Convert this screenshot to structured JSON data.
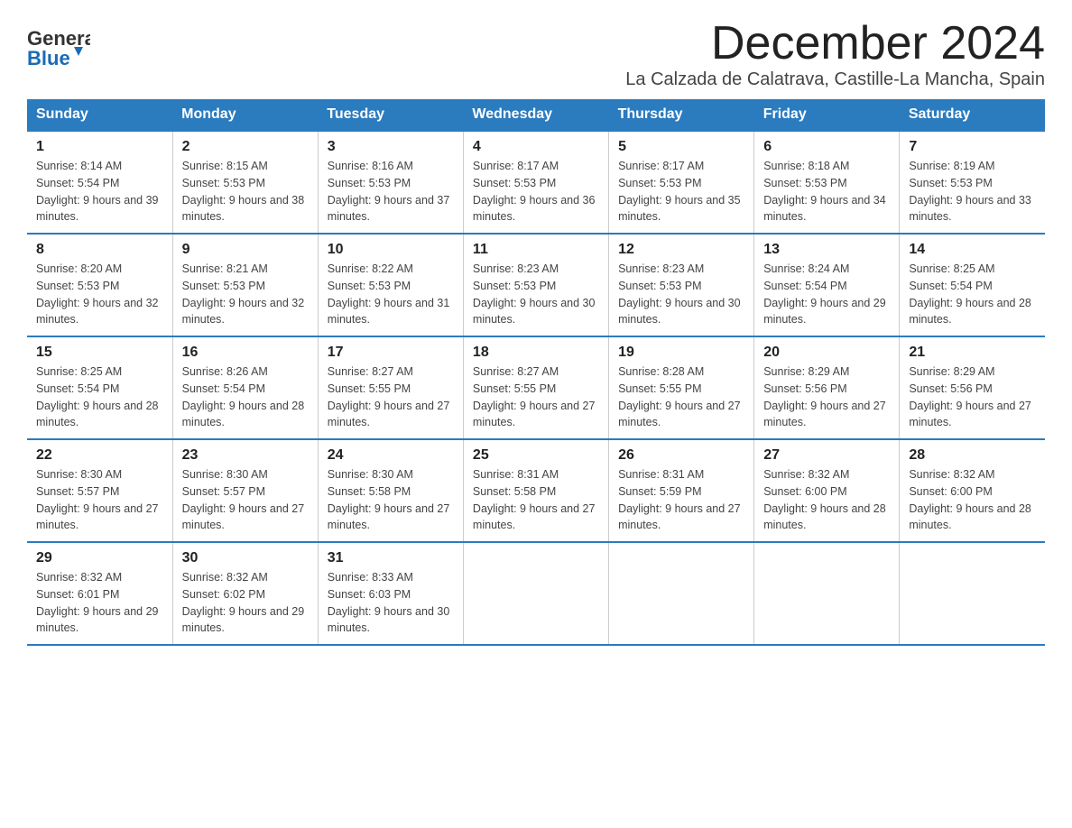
{
  "header": {
    "logo_general": "General",
    "logo_blue": "Blue",
    "month_title": "December 2024",
    "location": "La Calzada de Calatrava, Castille-La Mancha, Spain"
  },
  "days_of_week": [
    "Sunday",
    "Monday",
    "Tuesday",
    "Wednesday",
    "Thursday",
    "Friday",
    "Saturday"
  ],
  "weeks": [
    [
      {
        "day": "1",
        "sunrise": "Sunrise: 8:14 AM",
        "sunset": "Sunset: 5:54 PM",
        "daylight": "Daylight: 9 hours and 39 minutes."
      },
      {
        "day": "2",
        "sunrise": "Sunrise: 8:15 AM",
        "sunset": "Sunset: 5:53 PM",
        "daylight": "Daylight: 9 hours and 38 minutes."
      },
      {
        "day": "3",
        "sunrise": "Sunrise: 8:16 AM",
        "sunset": "Sunset: 5:53 PM",
        "daylight": "Daylight: 9 hours and 37 minutes."
      },
      {
        "day": "4",
        "sunrise": "Sunrise: 8:17 AM",
        "sunset": "Sunset: 5:53 PM",
        "daylight": "Daylight: 9 hours and 36 minutes."
      },
      {
        "day": "5",
        "sunrise": "Sunrise: 8:17 AM",
        "sunset": "Sunset: 5:53 PM",
        "daylight": "Daylight: 9 hours and 35 minutes."
      },
      {
        "day": "6",
        "sunrise": "Sunrise: 8:18 AM",
        "sunset": "Sunset: 5:53 PM",
        "daylight": "Daylight: 9 hours and 34 minutes."
      },
      {
        "day": "7",
        "sunrise": "Sunrise: 8:19 AM",
        "sunset": "Sunset: 5:53 PM",
        "daylight": "Daylight: 9 hours and 33 minutes."
      }
    ],
    [
      {
        "day": "8",
        "sunrise": "Sunrise: 8:20 AM",
        "sunset": "Sunset: 5:53 PM",
        "daylight": "Daylight: 9 hours and 32 minutes."
      },
      {
        "day": "9",
        "sunrise": "Sunrise: 8:21 AM",
        "sunset": "Sunset: 5:53 PM",
        "daylight": "Daylight: 9 hours and 32 minutes."
      },
      {
        "day": "10",
        "sunrise": "Sunrise: 8:22 AM",
        "sunset": "Sunset: 5:53 PM",
        "daylight": "Daylight: 9 hours and 31 minutes."
      },
      {
        "day": "11",
        "sunrise": "Sunrise: 8:23 AM",
        "sunset": "Sunset: 5:53 PM",
        "daylight": "Daylight: 9 hours and 30 minutes."
      },
      {
        "day": "12",
        "sunrise": "Sunrise: 8:23 AM",
        "sunset": "Sunset: 5:53 PM",
        "daylight": "Daylight: 9 hours and 30 minutes."
      },
      {
        "day": "13",
        "sunrise": "Sunrise: 8:24 AM",
        "sunset": "Sunset: 5:54 PM",
        "daylight": "Daylight: 9 hours and 29 minutes."
      },
      {
        "day": "14",
        "sunrise": "Sunrise: 8:25 AM",
        "sunset": "Sunset: 5:54 PM",
        "daylight": "Daylight: 9 hours and 28 minutes."
      }
    ],
    [
      {
        "day": "15",
        "sunrise": "Sunrise: 8:25 AM",
        "sunset": "Sunset: 5:54 PM",
        "daylight": "Daylight: 9 hours and 28 minutes."
      },
      {
        "day": "16",
        "sunrise": "Sunrise: 8:26 AM",
        "sunset": "Sunset: 5:54 PM",
        "daylight": "Daylight: 9 hours and 28 minutes."
      },
      {
        "day": "17",
        "sunrise": "Sunrise: 8:27 AM",
        "sunset": "Sunset: 5:55 PM",
        "daylight": "Daylight: 9 hours and 27 minutes."
      },
      {
        "day": "18",
        "sunrise": "Sunrise: 8:27 AM",
        "sunset": "Sunset: 5:55 PM",
        "daylight": "Daylight: 9 hours and 27 minutes."
      },
      {
        "day": "19",
        "sunrise": "Sunrise: 8:28 AM",
        "sunset": "Sunset: 5:55 PM",
        "daylight": "Daylight: 9 hours and 27 minutes."
      },
      {
        "day": "20",
        "sunrise": "Sunrise: 8:29 AM",
        "sunset": "Sunset: 5:56 PM",
        "daylight": "Daylight: 9 hours and 27 minutes."
      },
      {
        "day": "21",
        "sunrise": "Sunrise: 8:29 AM",
        "sunset": "Sunset: 5:56 PM",
        "daylight": "Daylight: 9 hours and 27 minutes."
      }
    ],
    [
      {
        "day": "22",
        "sunrise": "Sunrise: 8:30 AM",
        "sunset": "Sunset: 5:57 PM",
        "daylight": "Daylight: 9 hours and 27 minutes."
      },
      {
        "day": "23",
        "sunrise": "Sunrise: 8:30 AM",
        "sunset": "Sunset: 5:57 PM",
        "daylight": "Daylight: 9 hours and 27 minutes."
      },
      {
        "day": "24",
        "sunrise": "Sunrise: 8:30 AM",
        "sunset": "Sunset: 5:58 PM",
        "daylight": "Daylight: 9 hours and 27 minutes."
      },
      {
        "day": "25",
        "sunrise": "Sunrise: 8:31 AM",
        "sunset": "Sunset: 5:58 PM",
        "daylight": "Daylight: 9 hours and 27 minutes."
      },
      {
        "day": "26",
        "sunrise": "Sunrise: 8:31 AM",
        "sunset": "Sunset: 5:59 PM",
        "daylight": "Daylight: 9 hours and 27 minutes."
      },
      {
        "day": "27",
        "sunrise": "Sunrise: 8:32 AM",
        "sunset": "Sunset: 6:00 PM",
        "daylight": "Daylight: 9 hours and 28 minutes."
      },
      {
        "day": "28",
        "sunrise": "Sunrise: 8:32 AM",
        "sunset": "Sunset: 6:00 PM",
        "daylight": "Daylight: 9 hours and 28 minutes."
      }
    ],
    [
      {
        "day": "29",
        "sunrise": "Sunrise: 8:32 AM",
        "sunset": "Sunset: 6:01 PM",
        "daylight": "Daylight: 9 hours and 29 minutes."
      },
      {
        "day": "30",
        "sunrise": "Sunrise: 8:32 AM",
        "sunset": "Sunset: 6:02 PM",
        "daylight": "Daylight: 9 hours and 29 minutes."
      },
      {
        "day": "31",
        "sunrise": "Sunrise: 8:33 AM",
        "sunset": "Sunset: 6:03 PM",
        "daylight": "Daylight: 9 hours and 30 minutes."
      },
      null,
      null,
      null,
      null
    ]
  ],
  "accent_color": "#2b7bbf"
}
